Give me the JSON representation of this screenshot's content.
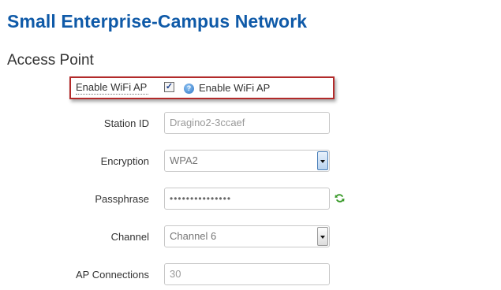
{
  "page": {
    "title": "Small Enterprise-Campus Network",
    "section_title": "Access Point"
  },
  "form": {
    "enable_wifi": {
      "label": "Enable WiFi AP",
      "checked": true,
      "check_mark": "✓",
      "help_icon": "help-icon",
      "help_text": "Enable WiFi AP"
    },
    "station_id": {
      "label": "Station ID",
      "placeholder": "Dragino2-3ccaef"
    },
    "encryption": {
      "label": "Encryption",
      "selected": "WPA2"
    },
    "passphrase": {
      "label": "Passphrase",
      "masked_value": "•••••••••••••••",
      "reveal_icon": "refresh-icon"
    },
    "channel": {
      "label": "Channel",
      "selected": "Channel 6"
    },
    "ap_connections": {
      "label": "AP Connections",
      "placeholder": "30"
    }
  },
  "colors": {
    "title": "#0f5aa8",
    "highlight_border": "#b22a2a"
  }
}
